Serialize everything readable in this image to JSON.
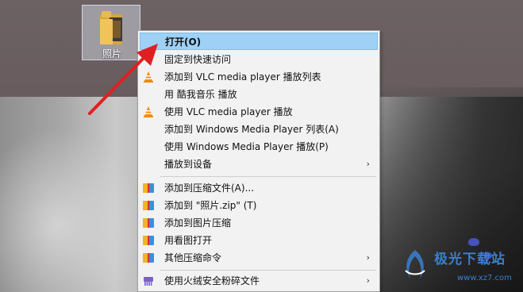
{
  "desktop": {
    "icon_label": "照片"
  },
  "context_menu": {
    "items": [
      {
        "label": "打开(O)",
        "icon": "none",
        "highlighted": true,
        "bold": true,
        "submenu": false
      },
      {
        "label": "固定到快速访问",
        "icon": "none",
        "highlighted": false,
        "bold": false,
        "submenu": false
      },
      {
        "label": "添加到 VLC media player 播放列表",
        "icon": "vlc-cone-icon",
        "highlighted": false,
        "bold": false,
        "submenu": false
      },
      {
        "label": "用 酷我音乐 播放",
        "icon": "none",
        "highlighted": false,
        "bold": false,
        "submenu": false
      },
      {
        "label": "使用 VLC media player 播放",
        "icon": "vlc-cone-icon",
        "highlighted": false,
        "bold": false,
        "submenu": false
      },
      {
        "label": "添加到 Windows Media Player 列表(A)",
        "icon": "none",
        "highlighted": false,
        "bold": false,
        "submenu": false
      },
      {
        "label": "使用 Windows Media Player 播放(P)",
        "icon": "none",
        "highlighted": false,
        "bold": false,
        "submenu": false
      },
      {
        "label": "播放到设备",
        "icon": "none",
        "highlighted": false,
        "bold": false,
        "submenu": true
      },
      {
        "label": "添加到压缩文件(A)...",
        "icon": "archive-icon",
        "highlighted": false,
        "bold": false,
        "submenu": false
      },
      {
        "label": "添加到 \"照片.zip\" (T)",
        "icon": "archive-icon",
        "highlighted": false,
        "bold": false,
        "submenu": false
      },
      {
        "label": "添加到图片压缩",
        "icon": "archive-icon",
        "highlighted": false,
        "bold": false,
        "submenu": false
      },
      {
        "label": "用看图打开",
        "icon": "archive-icon",
        "highlighted": false,
        "bold": false,
        "submenu": false
      },
      {
        "label": "其他压缩命令",
        "icon": "archive-icon",
        "highlighted": false,
        "bold": false,
        "submenu": true
      },
      {
        "label": "使用火绒安全粉碎文件",
        "icon": "shredder-icon",
        "highlighted": false,
        "bold": false,
        "submenu": true
      }
    ],
    "submenu_arrow": "›"
  },
  "colors": {
    "highlight": "#9fd0f5",
    "pointer_arrow": "#e02020",
    "watermark": "#3a7fd0"
  },
  "watermark": {
    "title": "极光下载站",
    "url": "www.xz7.com"
  }
}
